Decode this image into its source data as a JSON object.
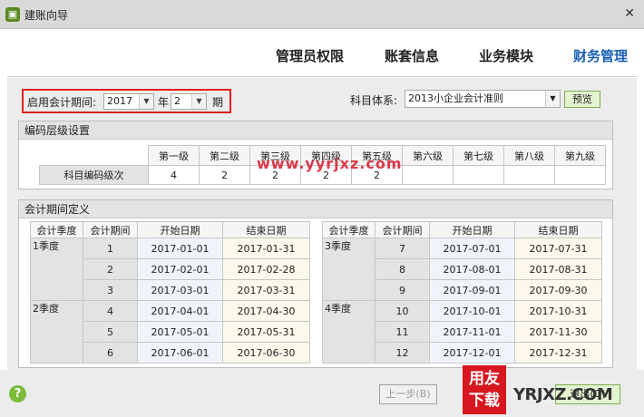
{
  "window": {
    "title": "建账向导",
    "close_glyph": "✕"
  },
  "steps": [
    {
      "label": "管理员权限"
    },
    {
      "label": "账套信息"
    },
    {
      "label": "业务模块"
    },
    {
      "label": "财务管理",
      "active": true
    }
  ],
  "period": {
    "label": "启用会计期间:",
    "year": "2017",
    "year_unit": "年",
    "month": "2",
    "month_unit": "期"
  },
  "subject_system": {
    "label": "科目体系:",
    "value": "2013小企业会计准则",
    "preview_label": "预览"
  },
  "code_levels": {
    "title": "编码层级设置",
    "headers": [
      "第一级",
      "第二级",
      "第三级",
      "第四级",
      "第五级",
      "第六级",
      "第七级",
      "第八级",
      "第九级"
    ],
    "row_label": "科目编码级次",
    "values": [
      "4",
      "2",
      "2",
      "2",
      "2",
      "",
      "",
      "",
      ""
    ]
  },
  "periods": {
    "title": "会计期间定义",
    "headers": [
      "会计季度",
      "会计期间",
      "开始日期",
      "结束日期"
    ],
    "left": [
      {
        "quarter": "1季度",
        "rows": [
          {
            "n": "1",
            "start": "2017-01-01",
            "end": "2017-01-31"
          },
          {
            "n": "2",
            "start": "2017-02-01",
            "end": "2017-02-28"
          },
          {
            "n": "3",
            "start": "2017-03-01",
            "end": "2017-03-31"
          }
        ]
      },
      {
        "quarter": "2季度",
        "rows": [
          {
            "n": "4",
            "start": "2017-04-01",
            "end": "2017-04-30"
          },
          {
            "n": "5",
            "start": "2017-05-01",
            "end": "2017-05-31"
          },
          {
            "n": "6",
            "start": "2017-06-01",
            "end": "2017-06-30"
          }
        ]
      }
    ],
    "right": [
      {
        "quarter": "3季度",
        "rows": [
          {
            "n": "7",
            "start": "2017-07-01",
            "end": "2017-07-31"
          },
          {
            "n": "8",
            "start": "2017-08-01",
            "end": "2017-08-31"
          },
          {
            "n": "9",
            "start": "2017-09-01",
            "end": "2017-09-30"
          }
        ]
      },
      {
        "quarter": "4季度",
        "rows": [
          {
            "n": "10",
            "start": "2017-10-01",
            "end": "2017-10-31"
          },
          {
            "n": "11",
            "start": "2017-11-01",
            "end": "2017-11-30"
          },
          {
            "n": "12",
            "start": "2017-12-01",
            "end": "2017-12-31"
          }
        ]
      }
    ]
  },
  "footer": {
    "help": "?",
    "prev_label": "上一步(B)",
    "finish_label": "退出(Q)"
  },
  "watermark": {
    "text": "www.yyrjxz.com",
    "badge_top": "用友",
    "badge_bottom": "下载",
    "logo": "YRJXZ.COM"
  }
}
